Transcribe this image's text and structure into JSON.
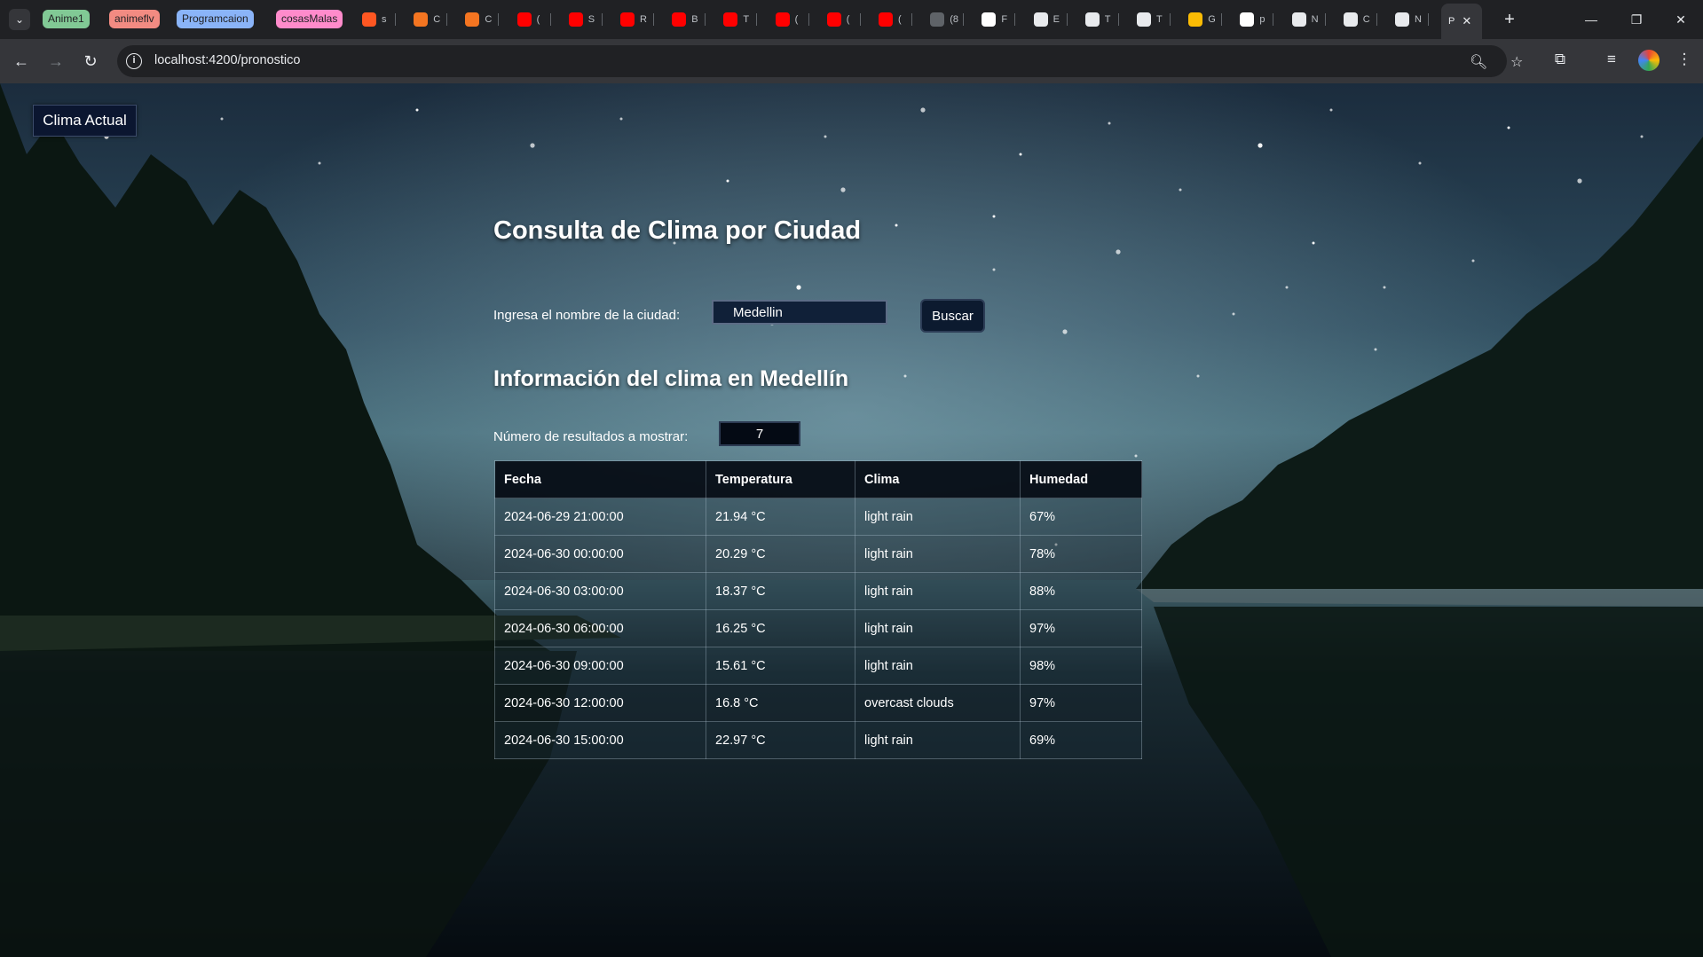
{
  "browser": {
    "tab_groups": [
      {
        "label": "Anime1",
        "color": "#81c995"
      },
      {
        "label": "animeflv",
        "color": "#f28b82"
      },
      {
        "label": "Programcaion",
        "color": "#8ab4f8"
      },
      {
        "label": "cosasMalas",
        "color": "#ff8bcb"
      }
    ],
    "tabs": [
      {
        "icon": "w-logo-icon",
        "letter": "s",
        "color": "#ff5722"
      },
      {
        "icon": "crunchy-icon",
        "letter": "C",
        "color": "#f47521"
      },
      {
        "icon": "crunchy-icon",
        "letter": "C",
        "color": "#f47521"
      },
      {
        "icon": "youtube-icon",
        "letter": "(",
        "color": "#ff0000"
      },
      {
        "icon": "youtube-icon",
        "letter": "S",
        "color": "#ff0000"
      },
      {
        "icon": "youtube-icon",
        "letter": "R",
        "color": "#ff0000"
      },
      {
        "icon": "youtube-icon",
        "letter": "B",
        "color": "#ff0000"
      },
      {
        "icon": "youtube-icon",
        "letter": "T",
        "color": "#ff0000"
      },
      {
        "icon": "youtube-icon",
        "letter": "(",
        "color": "#ff0000"
      },
      {
        "icon": "youtube-icon",
        "letter": "(",
        "color": "#ff0000"
      },
      {
        "icon": "youtube-icon",
        "letter": "(",
        "color": "#ff0000"
      },
      {
        "icon": "audio-icon",
        "letter": "(8",
        "color": "#5f6368"
      },
      {
        "icon": "google-icon",
        "letter": "F",
        "color": "#ffffff"
      },
      {
        "icon": "github-icon",
        "letter": "E",
        "color": "#e8eaed"
      },
      {
        "icon": "github-icon",
        "letter": "T",
        "color": "#e8eaed"
      },
      {
        "icon": "github-icon",
        "letter": "T",
        "color": "#e8eaed"
      },
      {
        "icon": "keep-icon",
        "letter": "G",
        "color": "#fbbc04"
      },
      {
        "icon": "google-icon",
        "letter": "p",
        "color": "#ffffff"
      },
      {
        "icon": "openai-icon",
        "letter": "N",
        "color": "#e8eaed"
      },
      {
        "icon": "openai-icon",
        "letter": "C",
        "color": "#e8eaed"
      },
      {
        "icon": "openai-icon",
        "letter": "N",
        "color": "#e8eaed"
      }
    ],
    "active_tab": {
      "letter": "P"
    },
    "url": "localhost:4200/pronostico"
  },
  "page": {
    "clima_actual_label": "Clima Actual",
    "title": "Consulta de Clima por Ciudad",
    "city_label": "Ingresa el nombre de la ciudad:",
    "city_value": "Medellin",
    "search_button": "Buscar",
    "section_title": "Información del clima en Medellín",
    "results_label": "Número de resultados a mostrar:",
    "results_value": "7",
    "table": {
      "headers": [
        "Fecha",
        "Temperatura",
        "Clima",
        "Humedad"
      ],
      "rows": [
        [
          "2024-06-29 21:00:00",
          "21.94 °C",
          "light rain",
          "67%"
        ],
        [
          "2024-06-30 00:00:00",
          "20.29 °C",
          "light rain",
          "78%"
        ],
        [
          "2024-06-30 03:00:00",
          "18.37 °C",
          "light rain",
          "88%"
        ],
        [
          "2024-06-30 06:00:00",
          "16.25 °C",
          "light rain",
          "97%"
        ],
        [
          "2024-06-30 09:00:00",
          "15.61 °C",
          "light rain",
          "98%"
        ],
        [
          "2024-06-30 12:00:00",
          "16.8 °C",
          "overcast clouds",
          "97%"
        ],
        [
          "2024-06-30 15:00:00",
          "22.97 °C",
          "light rain",
          "69%"
        ]
      ]
    }
  }
}
